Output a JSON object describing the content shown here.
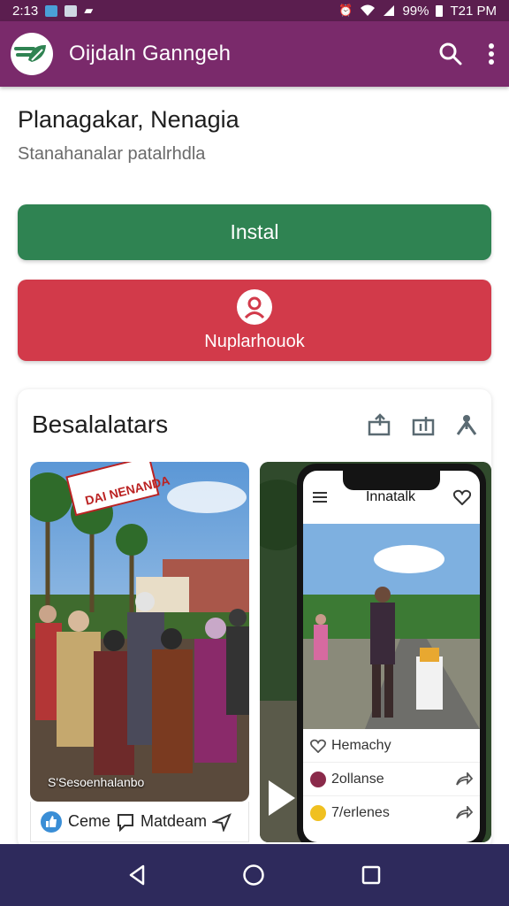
{
  "status_bar": {
    "time_left": "2:13",
    "battery": "99%",
    "time_right": "T21 PM"
  },
  "app_bar": {
    "title": "Oijdaln Ganngeh",
    "logo_icon": "leaf-logo-icon",
    "search_icon": "search-icon",
    "menu_icon": "more-vert-icon"
  },
  "header": {
    "title": "Planagakar, Nenagia",
    "subtitle": "Stanahanalar patalrhdla"
  },
  "actions": {
    "install_label": "Instal",
    "account_label": "Nuplarhouok",
    "account_icon": "person-icon"
  },
  "gallery": {
    "title": "Besalalatars",
    "icons": [
      "share-icon",
      "export-icon",
      "people-icon"
    ],
    "item1": {
      "banner": "DAI NENANDA",
      "caption": "S'Sesoenhalanbo",
      "like_label": "Ceme",
      "comment_label": "Matdeam"
    },
    "item2": {
      "phone_title": "Innatalk",
      "rows": [
        {
          "label": "Hemachy",
          "icon": "heart-outline-icon"
        },
        {
          "label": "2ollanse",
          "icon": "avatar-icon"
        },
        {
          "label": "7/erlenes",
          "icon": "emoji-icon"
        }
      ]
    }
  },
  "colors": {
    "app_bar": "#7a2a6b",
    "status_bar": "#5b1e4f",
    "install": "#2f8352",
    "account": "#d23a4a",
    "nav_bar": "#2e2a5c"
  },
  "nav": {
    "back_icon": "back-icon",
    "home_icon": "home-icon",
    "recents_icon": "recents-icon"
  }
}
